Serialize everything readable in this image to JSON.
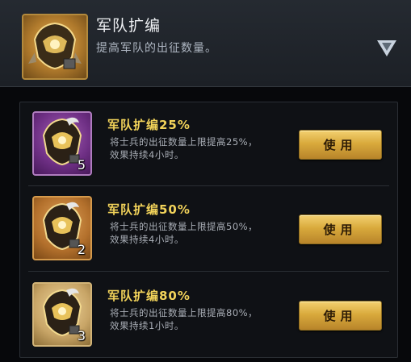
{
  "header": {
    "title": "军队扩编",
    "description": "提高军队的出征数量。",
    "icon": "armored-helmet-icon",
    "collapse_icon": "chevron-down-icon"
  },
  "items": [
    {
      "title": "军队扩编25%",
      "description_line1": "将士兵的出征数量上限提高25%，",
      "description_line2": "效果持续4小时。",
      "count": "5",
      "button_label": "使用",
      "rarity_color": "#7a3a8f",
      "icon": "armored-helmet-icon"
    },
    {
      "title": "军队扩编50%",
      "description_line1": "将士兵的出征数量上限提高50%，",
      "description_line2": "效果持续4小时。",
      "count": "2",
      "button_label": "使用",
      "rarity_color": "#c07a30",
      "icon": "armored-helmet-icon"
    },
    {
      "title": "军队扩编80%",
      "description_line1": "将士兵的出征数量上限提高80%，",
      "description_line2": "效果持续1小时。",
      "count": "3",
      "button_label": "使用",
      "rarity_color": "#d2b478",
      "icon": "armored-helmet-icon"
    }
  ],
  "colors": {
    "title_gold": "#f2d35a",
    "button_gold": "#d9aa3c",
    "panel_bg": "#0f1115"
  }
}
